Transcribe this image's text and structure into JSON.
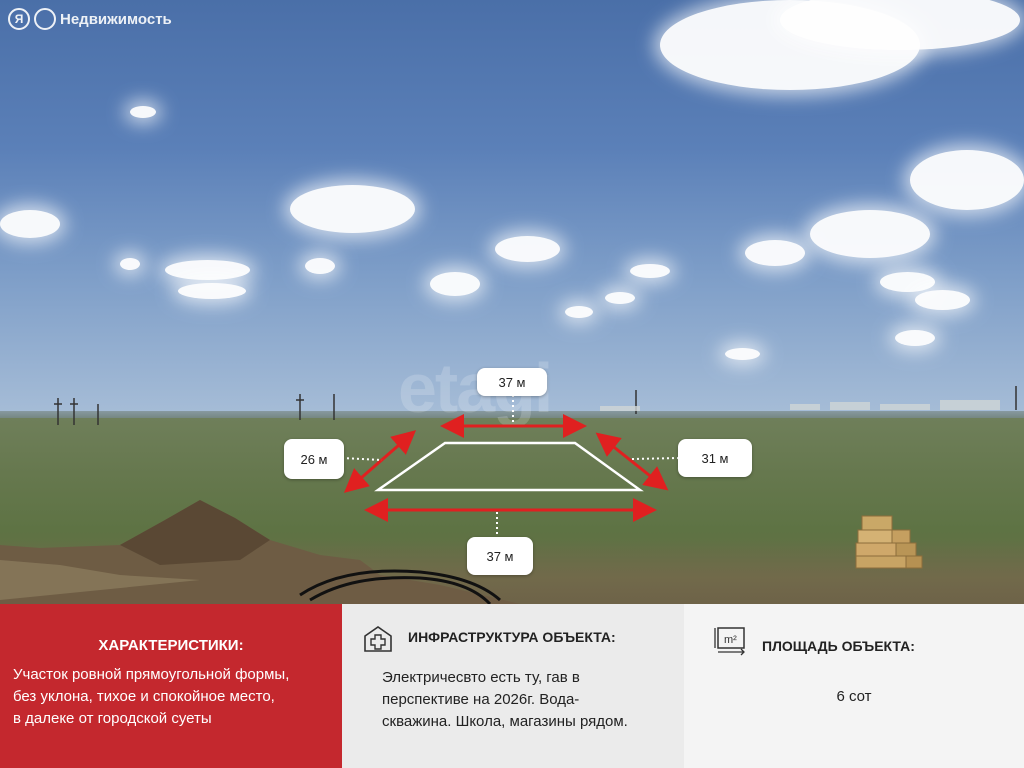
{
  "brand": {
    "logo_letter": "Я",
    "name": "Недвижимость"
  },
  "watermark": "etagi",
  "dimensions": {
    "top": "37 м",
    "left": "26 м",
    "right": "31 м",
    "bottom": "37 м"
  },
  "colors": {
    "accent": "#c4282e",
    "marker": "#e02020",
    "panel_gray": "#ebebeb"
  },
  "panels": {
    "characteristics": {
      "title": "ХАРАКТЕРИСТИКИ:",
      "lines": [
        "Участок ровной прямоугольной формы,",
        "без уклона, тихое и спокойное место,",
        "в далеке от городской суеты"
      ]
    },
    "infrastructure": {
      "icon": "hospital-plus-icon",
      "title": "ИНФРАСТРУКТУРА ОБЪЕКТА:",
      "lines": [
        "Электричесвто есть ту, гав в",
        "перспективе на 2026г. Вода-",
        "скважина. Школа, магазины рядом."
      ]
    },
    "area": {
      "icon": "area-m2-icon",
      "title": "ПЛОЩАДЬ ОБЪЕКТА:",
      "value": "6 сот"
    }
  }
}
